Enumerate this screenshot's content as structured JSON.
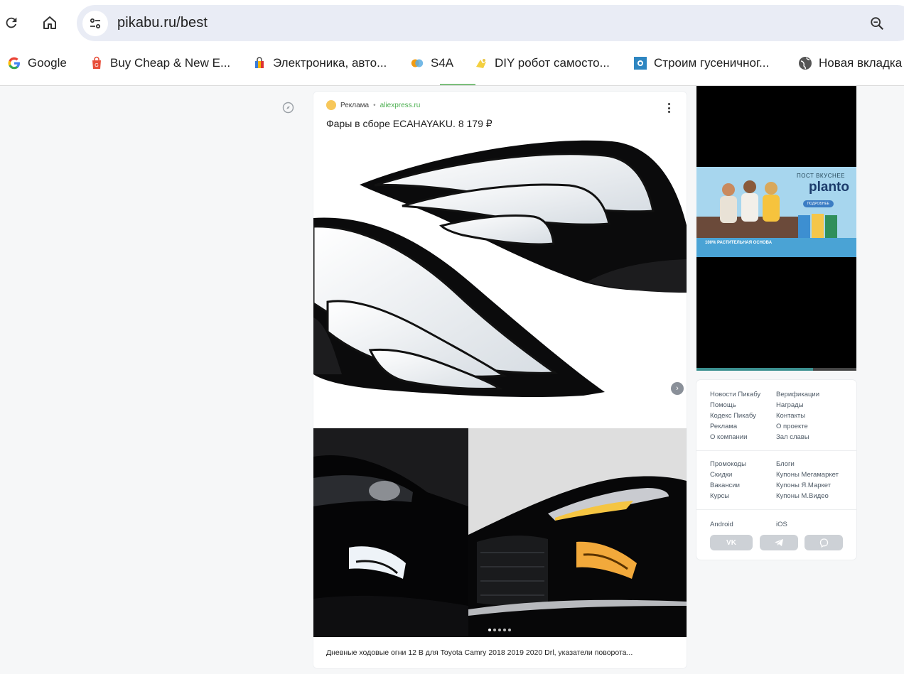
{
  "browser": {
    "url": "pikabu.ru/best",
    "bookmarks": [
      {
        "label": "Google",
        "icon": "google-icon"
      },
      {
        "label": "Buy Cheap & New E...",
        "icon": "shopping-bag-icon"
      },
      {
        "label": "Электроника, авто...",
        "icon": "shopping-bag-icon"
      },
      {
        "label": "S4A",
        "icon": "s4a-icon"
      },
      {
        "label": "DIY робот самосто...",
        "icon": "robot-icon"
      },
      {
        "label": "Строим гусеничног...",
        "icon": "gear-icon"
      },
      {
        "label": "Новая вкладка",
        "icon": "globe-icon"
      }
    ]
  },
  "post": {
    "ad_label": "Реклама",
    "ad_domain": "aliexpress.ru",
    "title": "Фары в сборе ECAHAYAKU. 8 179 ₽",
    "caption": "Дневные ходовые огни 12 В для Toyota Camry 2018 2019 2020 Drl, указатели поворота...",
    "slides_count": 5,
    "active_slide": 1
  },
  "sidebar_ad": {
    "tagline": "ПОСТ ВКУСНЕЕ",
    "brand": "planto",
    "cta": "ПОДРОБНЕЕ",
    "strip_text": "100% РАСТИТЕЛЬНАЯ ОСНОВА",
    "progress": 0.73
  },
  "footer_links": {
    "group1_left": [
      "Новости Пикабу",
      "Помощь",
      "Кодекс Пикабу",
      "Реклама",
      "О компании"
    ],
    "group1_right": [
      "Верификации",
      "Награды",
      "Контакты",
      "О проекте",
      "Зал славы"
    ],
    "group2_left": [
      "Промокоды",
      "Скидки",
      "Вакансии",
      "Курсы"
    ],
    "group2_right": [
      "Блоги",
      "Купоны Мегамаркет",
      "Купоны Я.Маркет",
      "Купоны М.Видео"
    ],
    "apps": [
      "Android",
      "iOS"
    ],
    "social": [
      "vk-icon",
      "telegram-icon",
      "viber-icon"
    ]
  },
  "colors": {
    "accent_green": "#4caf50",
    "omnibox_bg": "#e9ecf5",
    "page_bg": "#f6f7f8"
  }
}
